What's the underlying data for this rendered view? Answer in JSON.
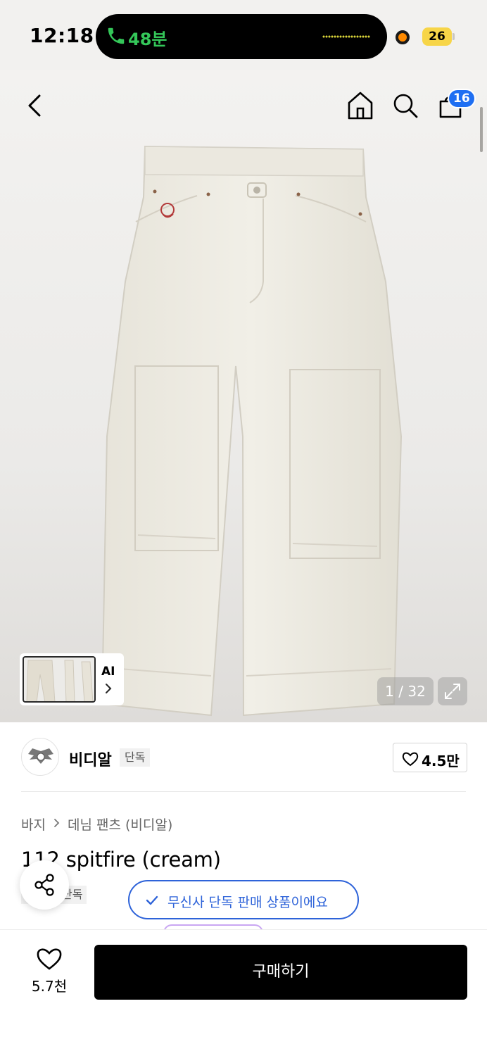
{
  "status_bar": {
    "time": "12:18",
    "call_duration": "48분",
    "battery": "26",
    "icons": [
      "phone-icon",
      "recording-dot",
      "battery-icon"
    ]
  },
  "header": {
    "cart_count": "16",
    "icons": [
      "back-arrow-icon",
      "home-icon",
      "search-icon",
      "cart-icon"
    ]
  },
  "gallery": {
    "ai_label": "AI",
    "counter": "1 / 32",
    "icons": [
      "chevron-right-icon",
      "expand-icon"
    ]
  },
  "brand": {
    "name": "비디알",
    "tag": "단독",
    "like_count": "4.5만"
  },
  "product": {
    "category": "바지",
    "subcategory": "데님 팬츠 (비디알)",
    "title": "112 spitfire (cream)",
    "tag": "단독",
    "exclusive_notice": "무신사 단독 판매 상품이에요"
  },
  "bottom_bar": {
    "wish_count": "5.7천",
    "buy_label": "구매하기"
  },
  "colors": {
    "accent_blue": "#2e63d9",
    "badge_blue": "#1f6ff2",
    "call_green": "#34c759",
    "buy_button": "#000000"
  }
}
